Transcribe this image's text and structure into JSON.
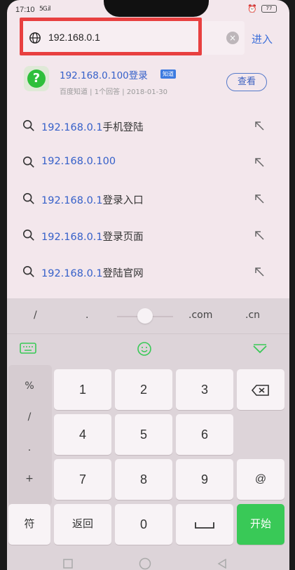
{
  "status_bar": {
    "time": "17:10",
    "signal": "5G.il",
    "battery": "77"
  },
  "address_bar": {
    "url": "192.168.0.1",
    "enter_label": "进入"
  },
  "top_suggestion": {
    "title": "192.168.0.100登录",
    "badge": "知道",
    "meta": "百度知道 | 1个回答 | 2018-01-30",
    "view_label": "查看"
  },
  "suggestions": [
    {
      "prefix": "192.168.0.1",
      "rest": "手机登陆"
    },
    {
      "prefix": "192.168.0.",
      "rest": "100"
    },
    {
      "prefix": "192.168.0.1",
      "rest": "登录入口"
    },
    {
      "prefix": "192.168.0.1",
      "rest": "登录页面"
    },
    {
      "prefix": "192.168.0.1",
      "rest": "登陆官网"
    }
  ],
  "keyboard": {
    "shortcuts": [
      "/",
      ".",
      ".com",
      ".cn"
    ],
    "side_keys": [
      "%",
      "/",
      ".",
      "+"
    ],
    "digits": [
      "1",
      "2",
      "3",
      "4",
      "5",
      "6",
      "7",
      "8",
      "9"
    ],
    "symbol_key": "符",
    "back_key": "返回",
    "zero_key": "0",
    "at_key": "@",
    "go_key": "开始"
  },
  "colors": {
    "accent_blue": "#3560c9",
    "go_green": "#39c957",
    "highlight_red": "#e84040"
  }
}
